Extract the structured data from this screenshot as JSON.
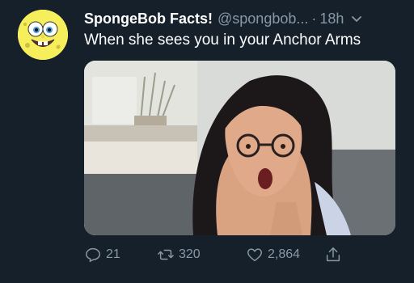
{
  "tweet": {
    "display_name": "SpongeBob Facts!",
    "handle": "@spongbob...",
    "separator": "·",
    "time": "18h",
    "text": "When she sees you in your Anchor Arms"
  },
  "actions": {
    "replies": "21",
    "retweets": "320",
    "likes": "2,864"
  },
  "icons": {
    "avatar": "spongebob-face-icon",
    "caret": "chevron-down-icon",
    "reply": "reply-bubble-icon",
    "retweet": "retweet-icon",
    "like": "heart-icon",
    "share": "share-upload-icon"
  },
  "colors": {
    "background": "#15202b",
    "primary_text": "#ffffff",
    "secondary_text": "#8899a6"
  }
}
